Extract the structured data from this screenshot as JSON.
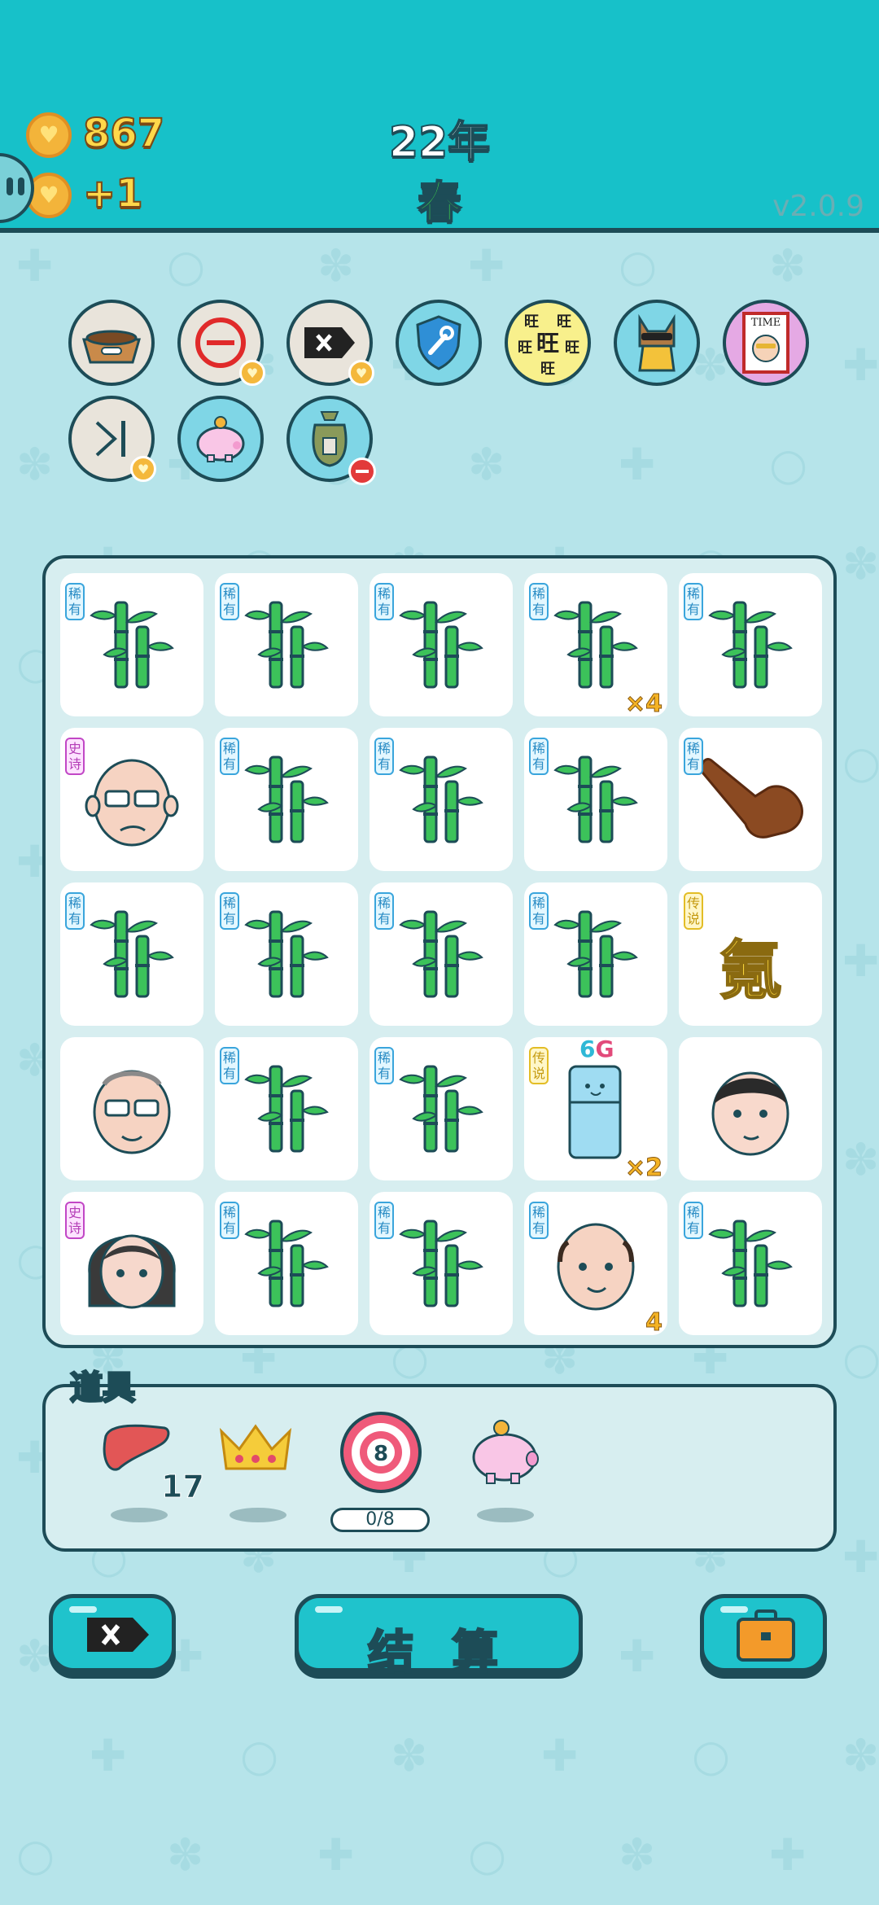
{
  "header": {
    "coins": "867",
    "income": "+1",
    "year": "22年",
    "season": "春",
    "version": "v2.0.9"
  },
  "items_row": [
    {
      "name": "dog-food-bowl-icon"
    },
    {
      "name": "remove-symbol-icon"
    },
    {
      "name": "delete-tag-icon"
    },
    {
      "name": "shield-wrench-icon"
    },
    {
      "name": "wang-tiles-icon",
      "text": "旺"
    },
    {
      "name": "dog-with-sunglasses-icon"
    },
    {
      "name": "time-magazine-icon",
      "text": "TIME"
    },
    {
      "name": "skip-icon"
    },
    {
      "name": "piggy-bank-icon"
    },
    {
      "name": "money-bag-icon"
    }
  ],
  "rarity_labels": {
    "rare": "稀有",
    "epic": "史诗",
    "legend": "传说"
  },
  "board": [
    [
      {
        "type": "bamboo",
        "rarity": "rare"
      },
      {
        "type": "bamboo",
        "rarity": "rare"
      },
      {
        "type": "bamboo",
        "rarity": "rare"
      },
      {
        "type": "bamboo",
        "rarity": "rare",
        "mult": "×4"
      },
      {
        "type": "bamboo",
        "rarity": "rare"
      }
    ],
    [
      {
        "type": "old-man-glasses",
        "rarity": "epic"
      },
      {
        "type": "bamboo",
        "rarity": "rare"
      },
      {
        "type": "bamboo",
        "rarity": "rare"
      },
      {
        "type": "bamboo",
        "rarity": "rare"
      },
      {
        "type": "pointing-hand",
        "rarity": "rare"
      }
    ],
    [
      {
        "type": "bamboo",
        "rarity": "rare"
      },
      {
        "type": "bamboo",
        "rarity": "rare"
      },
      {
        "type": "bamboo",
        "rarity": "rare"
      },
      {
        "type": "bamboo",
        "rarity": "rare"
      },
      {
        "type": "char",
        "rarity": "legend",
        "text": "氪"
      }
    ],
    [
      {
        "type": "grandpa-glasses",
        "rarity": ""
      },
      {
        "type": "bamboo",
        "rarity": "rare"
      },
      {
        "type": "bamboo",
        "rarity": "rare"
      },
      {
        "type": "fridge",
        "rarity": "legend",
        "text": "6G",
        "mult": "×2"
      },
      {
        "type": "man-face",
        "rarity": ""
      }
    ],
    [
      {
        "type": "woman-face",
        "rarity": "epic"
      },
      {
        "type": "bamboo",
        "rarity": "rare"
      },
      {
        "type": "bamboo",
        "rarity": "rare"
      },
      {
        "type": "bald-man",
        "rarity": "rare",
        "mult": "4"
      },
      {
        "type": "bamboo",
        "rarity": "rare"
      }
    ]
  ],
  "tools": {
    "title": "道具",
    "liver_count": "17",
    "dart_number": "8",
    "dart_progress": "0/8"
  },
  "buttons": {
    "settle_label": "结 算"
  },
  "colors": {
    "header": "#17c1c9",
    "background": "#b6e4ea",
    "outline": "#1d4c57",
    "coin": "#f3b43a",
    "button": "#1fc3cc"
  }
}
